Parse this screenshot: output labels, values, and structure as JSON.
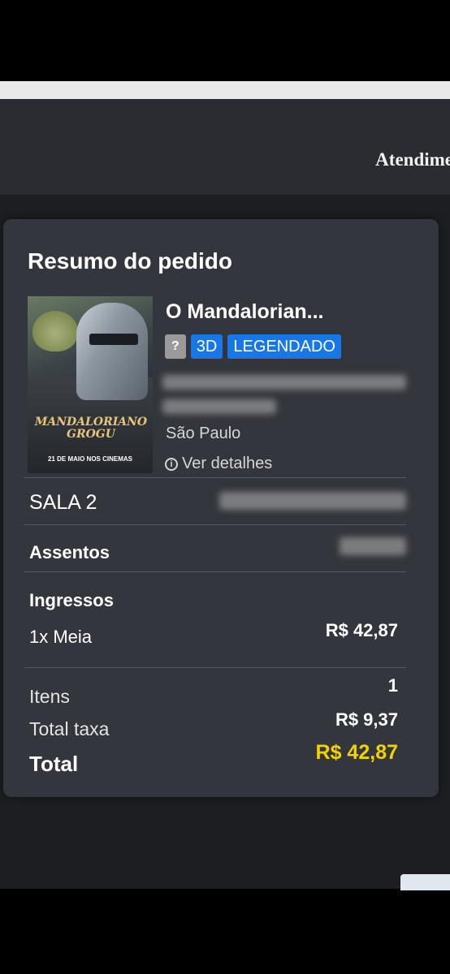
{
  "header": {
    "atendimento_label": "Atendime"
  },
  "order_summary": {
    "title": "Resumo do pedido",
    "movie": {
      "title": "O Mandalorian...",
      "poster_title": "MANDALORIANO GROGU",
      "poster_date": "21 DE MAIO NOS CINEMAS",
      "rating_badge": "?",
      "format_badge": "3D",
      "language_badge": "LEGENDADO",
      "city": "São Paulo",
      "details_link": "Ver detalhes"
    },
    "room": "SALA 2",
    "seats_label": "Assentos",
    "tickets_label": "Ingressos",
    "ticket_line": {
      "label": "1x Meia",
      "price": "R$ 42,87"
    },
    "items_label": "Itens",
    "items_value": "1",
    "fee_label": "Total taxa",
    "fee_value": "R$ 9,37",
    "total_label": "Total",
    "total_value": "R$ 42,87"
  },
  "colors": {
    "card_bg": "#33363c",
    "badge_blue": "#1877e6",
    "total_highlight": "#f5d100",
    "rating_badge": "#9a9a9a"
  },
  "icons": {
    "details": "info-icon"
  }
}
